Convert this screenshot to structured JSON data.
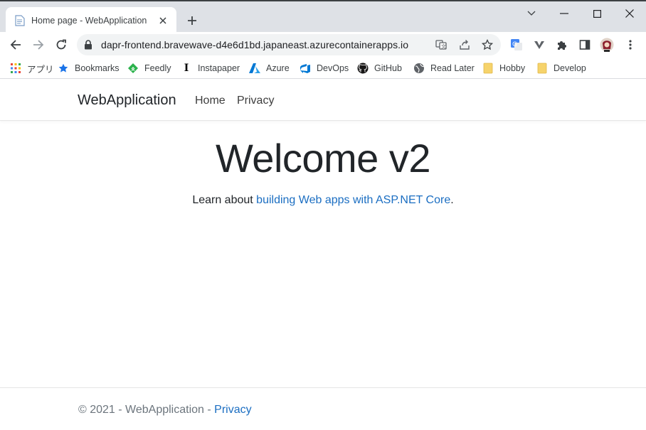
{
  "browser": {
    "tab_title": "Home page - WebApplication",
    "url": "dapr-frontend.bravewave-d4e6d1bd.japaneast.azurecontainerapps.io",
    "bookmarks": [
      {
        "label": "アプリ",
        "icon": "apps-grid-icon"
      },
      {
        "label": "Bookmarks",
        "icon": "star-icon",
        "color": "#1a73e8"
      },
      {
        "label": "Feedly",
        "icon": "feedly-icon",
        "color": "#2bb24c"
      },
      {
        "label": "Instapaper",
        "icon": "instapaper-icon"
      },
      {
        "label": "Azure",
        "icon": "azure-icon",
        "color": "#0078d4"
      },
      {
        "label": "DevOps",
        "icon": "devops-icon",
        "color": "#0078d4"
      },
      {
        "label": "GitHub",
        "icon": "github-icon"
      },
      {
        "label": "Read Later",
        "icon": "globe-icon"
      },
      {
        "label": "Hobby",
        "icon": "folder-icon",
        "color": "#f6d36b"
      },
      {
        "label": "Develop",
        "icon": "folder-icon",
        "color": "#f6d36b"
      }
    ]
  },
  "site": {
    "brand": "WebApplication",
    "nav": [
      "Home",
      "Privacy"
    ],
    "heading": "Welcome v2",
    "lead_prefix": "Learn about ",
    "lead_link": "building Web apps with ASP.NET Core",
    "lead_suffix": ".",
    "footer_text": "© 2021 - WebApplication - ",
    "footer_link": "Privacy",
    "link_color": "#1b6ec2"
  }
}
